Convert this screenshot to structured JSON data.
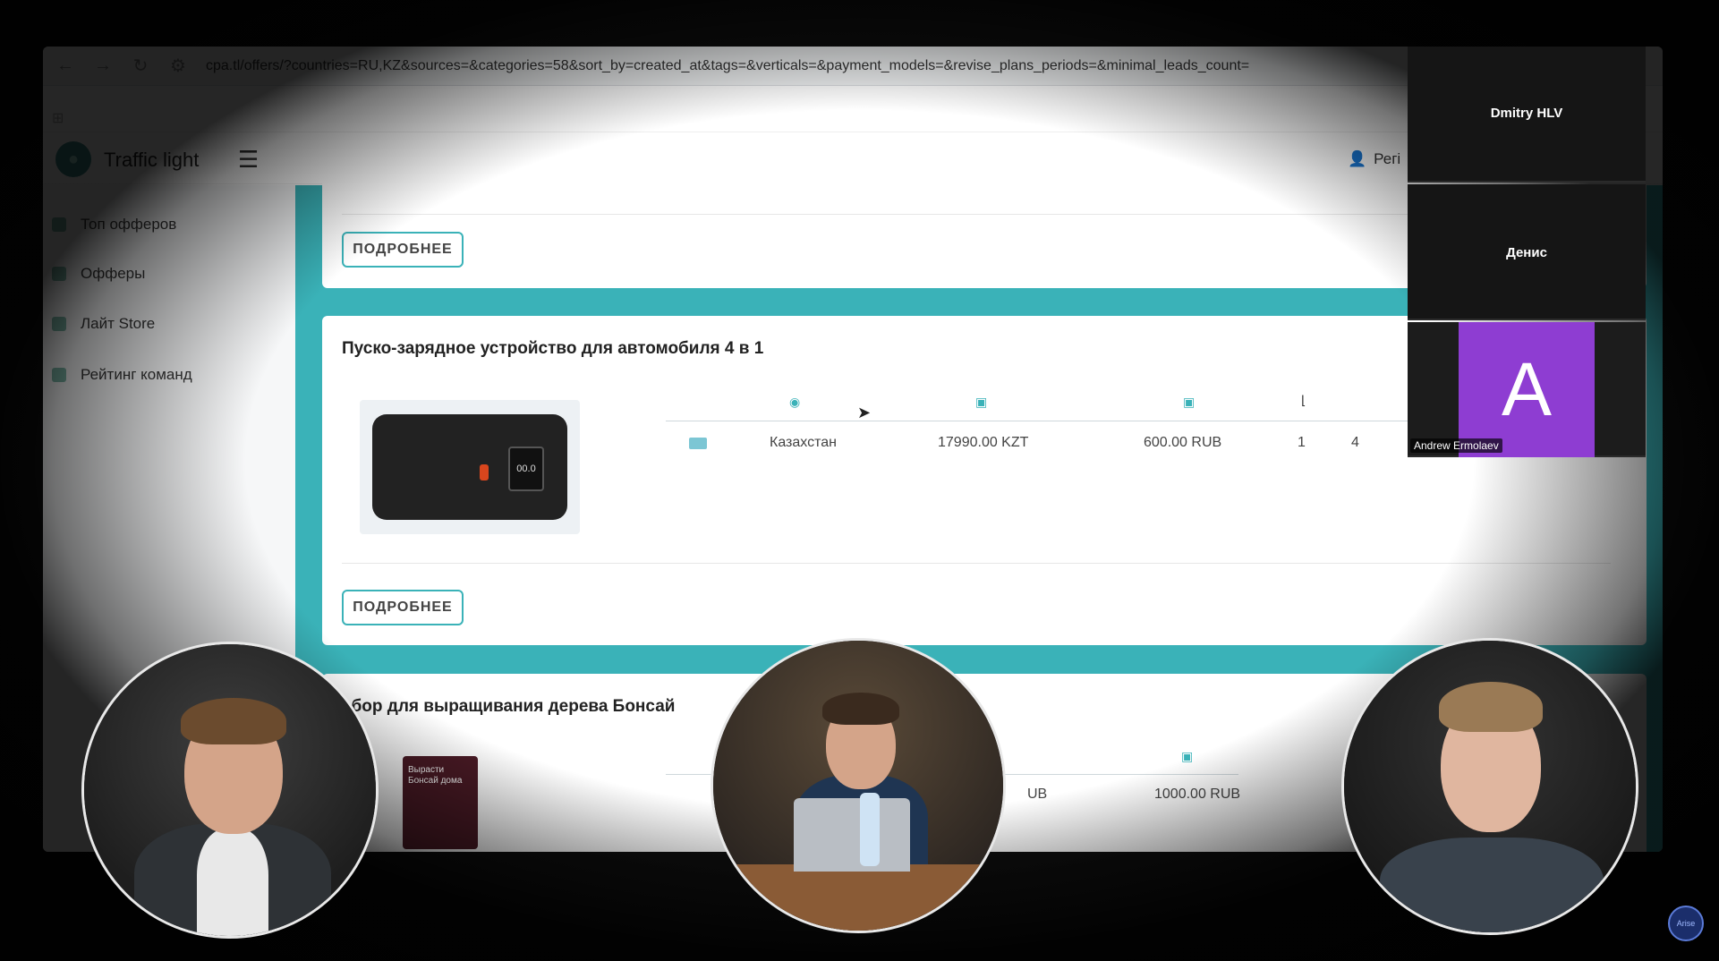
{
  "browser": {
    "url": "cpa.tl/offers/?countries=RU,KZ&sources=&categories=58&sort_by=created_at&tags=&verticals=&payment_models=&revise_plans_periods=&minimal_leads_count="
  },
  "app": {
    "brand": "Traffic light",
    "register_label": "Регі"
  },
  "sidebar": {
    "items": [
      {
        "label": "Топ офферов",
        "icon": "flame-icon"
      },
      {
        "label": "Офферы",
        "icon": "cart-icon"
      },
      {
        "label": "Лайт Store",
        "icon": "store-icon"
      },
      {
        "label": "Рейтинг команд",
        "icon": "trophy-icon"
      }
    ]
  },
  "offers": [
    {
      "more_label": "ПОДРОБНЕЕ"
    },
    {
      "title": "Пуско-зарядное устройство для автомобиля 4 в 1",
      "row": {
        "country": "Казахстан",
        "price": "17990.00 KZT",
        "payout": "600.00 RUB",
        "leads": "1",
        "extra": "4"
      },
      "more_label": "ПОДРОБНЕЕ"
    },
    {
      "title": "абор для выращивания дерева Бонсай",
      "row": {
        "price_tail": "UB",
        "payout": "1000.00 RUB"
      },
      "box_text": "Вырасти Бонсай дома"
    }
  ],
  "participants": [
    {
      "name": "Dmitry HLV"
    },
    {
      "name": "Денис"
    },
    {
      "name": "Andrew Ermolaev",
      "initial": "A",
      "color": "#8e3dd2"
    }
  ],
  "corner_logo_text": "Arise"
}
